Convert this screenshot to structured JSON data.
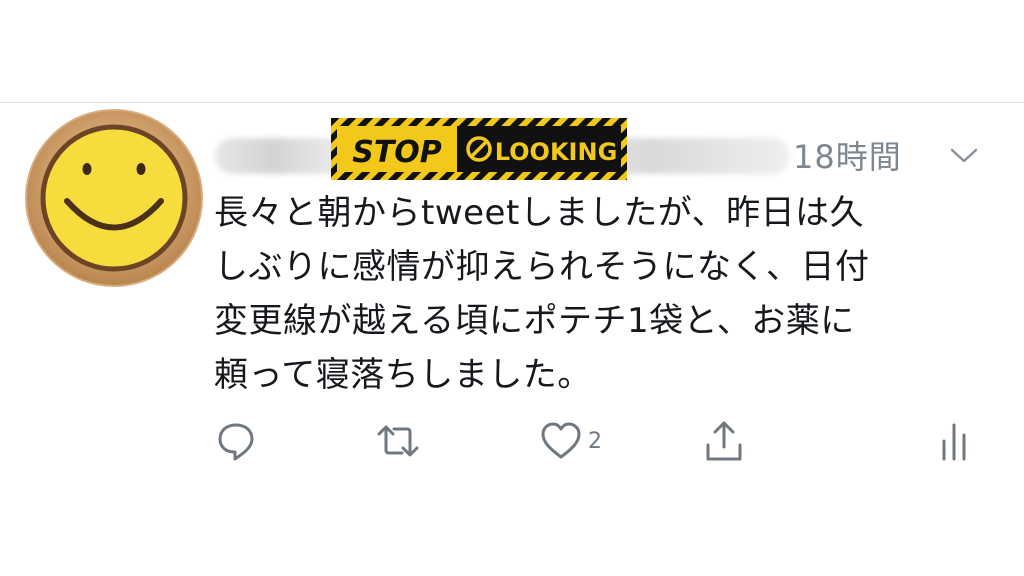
{
  "tweet": {
    "author_name_obscured": "",
    "overlay_banner": {
      "stop_label": "STOP",
      "looking_label": "LOOKING"
    },
    "timestamp": "18時間",
    "text_lines": [
      "長々と朝からtweetしましたが、昨日は久",
      "しぶりに感情が抑えられそうになく、日付",
      "変更線が越える頃にポテチ1袋と、お薬に",
      "頼って寝落ちしました。"
    ],
    "actions": {
      "reply_icon": "reply-bubble",
      "retweet_icon": "retweet-arrows",
      "like_icon": "heart",
      "like_count": "2",
      "share_icon": "share-upload",
      "analytics_icon": "bar-analytics"
    }
  },
  "colors": {
    "text": "#15181c",
    "muted": "#7d8791",
    "divider": "#dfe3e7",
    "avatar_face": "#f6dd3d",
    "avatar_ring": "#c79b63",
    "banner_yellow": "#f2c81b",
    "banner_black": "#111111"
  }
}
